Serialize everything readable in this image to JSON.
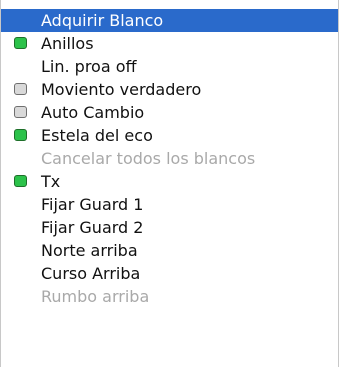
{
  "menu": {
    "items": [
      {
        "label": "Adquirir Blanco",
        "state": "selected"
      },
      {
        "label": "Anillos",
        "indicator": "on"
      },
      {
        "label": "Lin. proa off"
      },
      {
        "label": "Moviento verdadero",
        "indicator": "off"
      },
      {
        "label": "Auto Cambio",
        "indicator": "off"
      },
      {
        "label": "Estela del eco",
        "indicator": "on"
      },
      {
        "label": "Cancelar todos los blancos",
        "state": "disabled"
      },
      {
        "label": "Tx",
        "indicator": "on"
      },
      {
        "label": "Fijar Guard 1"
      },
      {
        "label": "Fijar Guard 2"
      },
      {
        "label": "Norte arriba"
      },
      {
        "label": "Curso Arriba"
      },
      {
        "label": "Rumbo arriba",
        "state": "disabled"
      }
    ]
  },
  "colors": {
    "selected_bg": "#2a6acb",
    "indicator_on": "#2cc24a",
    "indicator_off": "#d9d9d9",
    "disabled_text": "#a9a9a9"
  }
}
